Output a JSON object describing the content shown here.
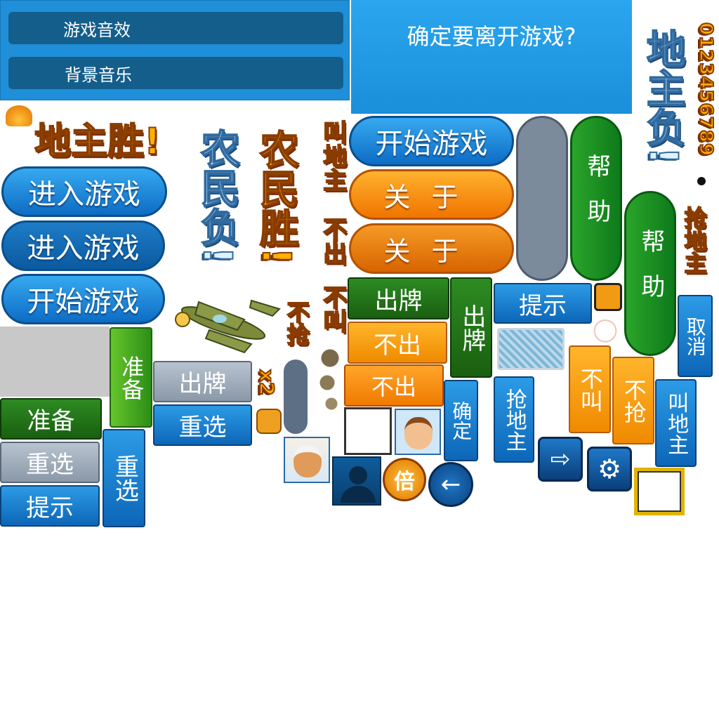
{
  "settings_panel": {
    "sound_effects_label": "游戏音效",
    "background_music_label": "背景音乐"
  },
  "exit_dialog": {
    "title": "确定要离开游戏?"
  },
  "banners": {
    "landlord_win": "地主胜!",
    "farmer_win": "农民胜!",
    "farmer_lose": "农民负!",
    "landlord_lose": "地主负!"
  },
  "menu_buttons": {
    "enter_game_1": "进入游戏",
    "enter_game_2": "进入游戏",
    "start_game_1": "开始游戏",
    "start_game_2": "开始游戏",
    "about_1": "关于",
    "about_2": "关于",
    "help_1": "帮助",
    "help_2": "帮助"
  },
  "action_labels": {
    "call_landlord": "叫地主",
    "no_play_vertical": "不出",
    "no_call_vertical": "不叫",
    "no_grab_vertical": "不抢",
    "grab_landlord_gold": "抢地主",
    "multiplier": "x2"
  },
  "game_buttons": {
    "play_cards_green": "出牌",
    "no_play_orange_1": "不出",
    "no_play_orange_2": "不出",
    "play_cards_vertical": "出牌",
    "hint_blue": "提示",
    "play_cards_gray": "出牌",
    "reselect_blue": "重选",
    "ready_vertical": "准备",
    "ready_dark": "准备",
    "reselect_gray": "重选",
    "hint_blue_2": "提示",
    "reselect_vertical": "重选",
    "confirm_vertical": "确定",
    "grab_landlord_vertical": "抢地主",
    "no_call_orange": "不叫",
    "no_grab_orange": "不抢",
    "call_landlord_vertical": "叫地主",
    "cancel_vertical": "取消"
  },
  "digits": "0123456789",
  "coin_label": "倍",
  "colors": {
    "panel_blue": "#1e8fd8",
    "button_blue": "#0d66b8",
    "orange": "#f08a00",
    "green": "#1a7d1a",
    "gold": "#ffb000"
  },
  "icons": [
    "plane-icon",
    "avatar-icon",
    "coin-icon",
    "back-arrow-icon",
    "exit-icon",
    "gear-icon",
    "glove-icon",
    "card-back-icon"
  ]
}
